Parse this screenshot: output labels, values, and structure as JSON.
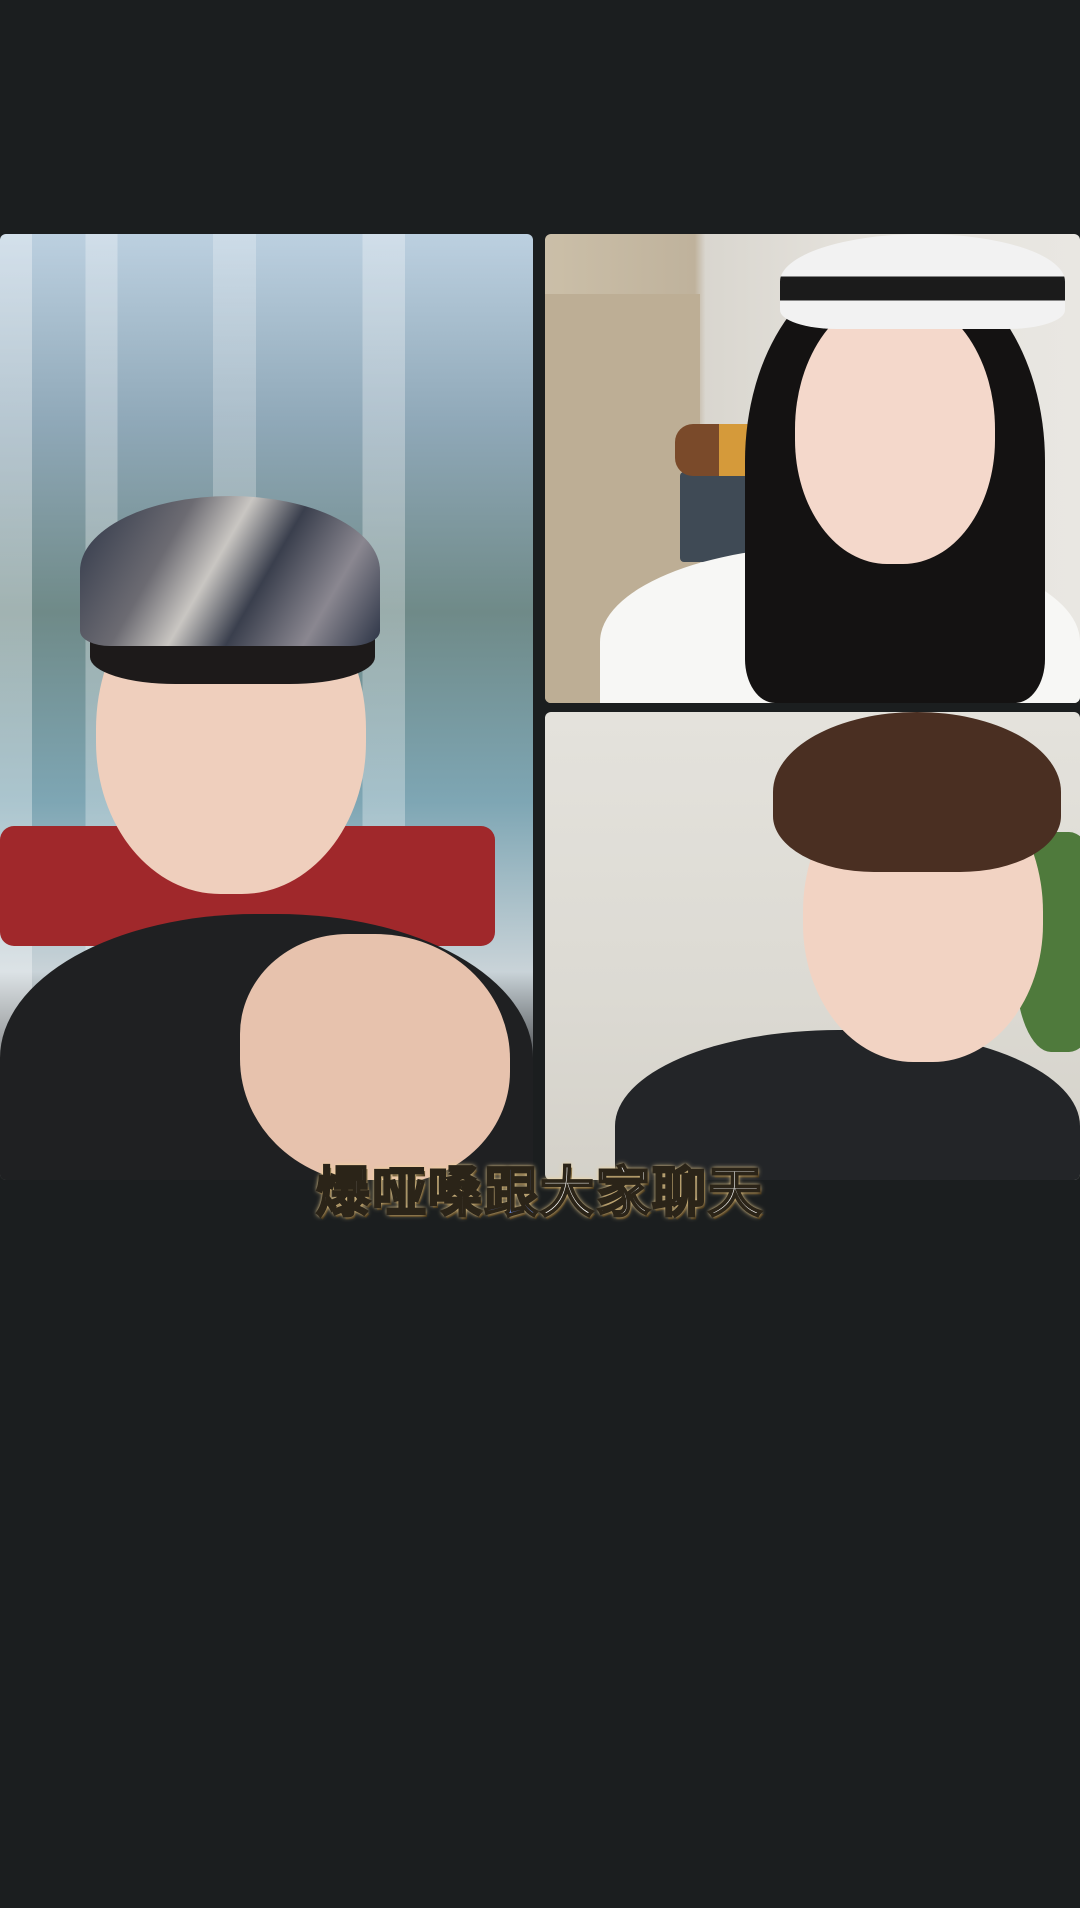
{
  "caption": {
    "before": "爆哑嗓",
    "highlight": "跟",
    "after": "大家聊天"
  },
  "colors": {
    "background": "#1b1e1f",
    "caption_text": "#ffffff",
    "caption_highlight": "#6f8fe6"
  },
  "participants": [
    {
      "tile": "left",
      "description_icon": "video-feed-man-with-cap"
    },
    {
      "tile": "top-right",
      "description_icon": "video-feed-woman-with-headband"
    },
    {
      "tile": "bottom-right",
      "description_icon": "video-feed-young-man"
    }
  ]
}
